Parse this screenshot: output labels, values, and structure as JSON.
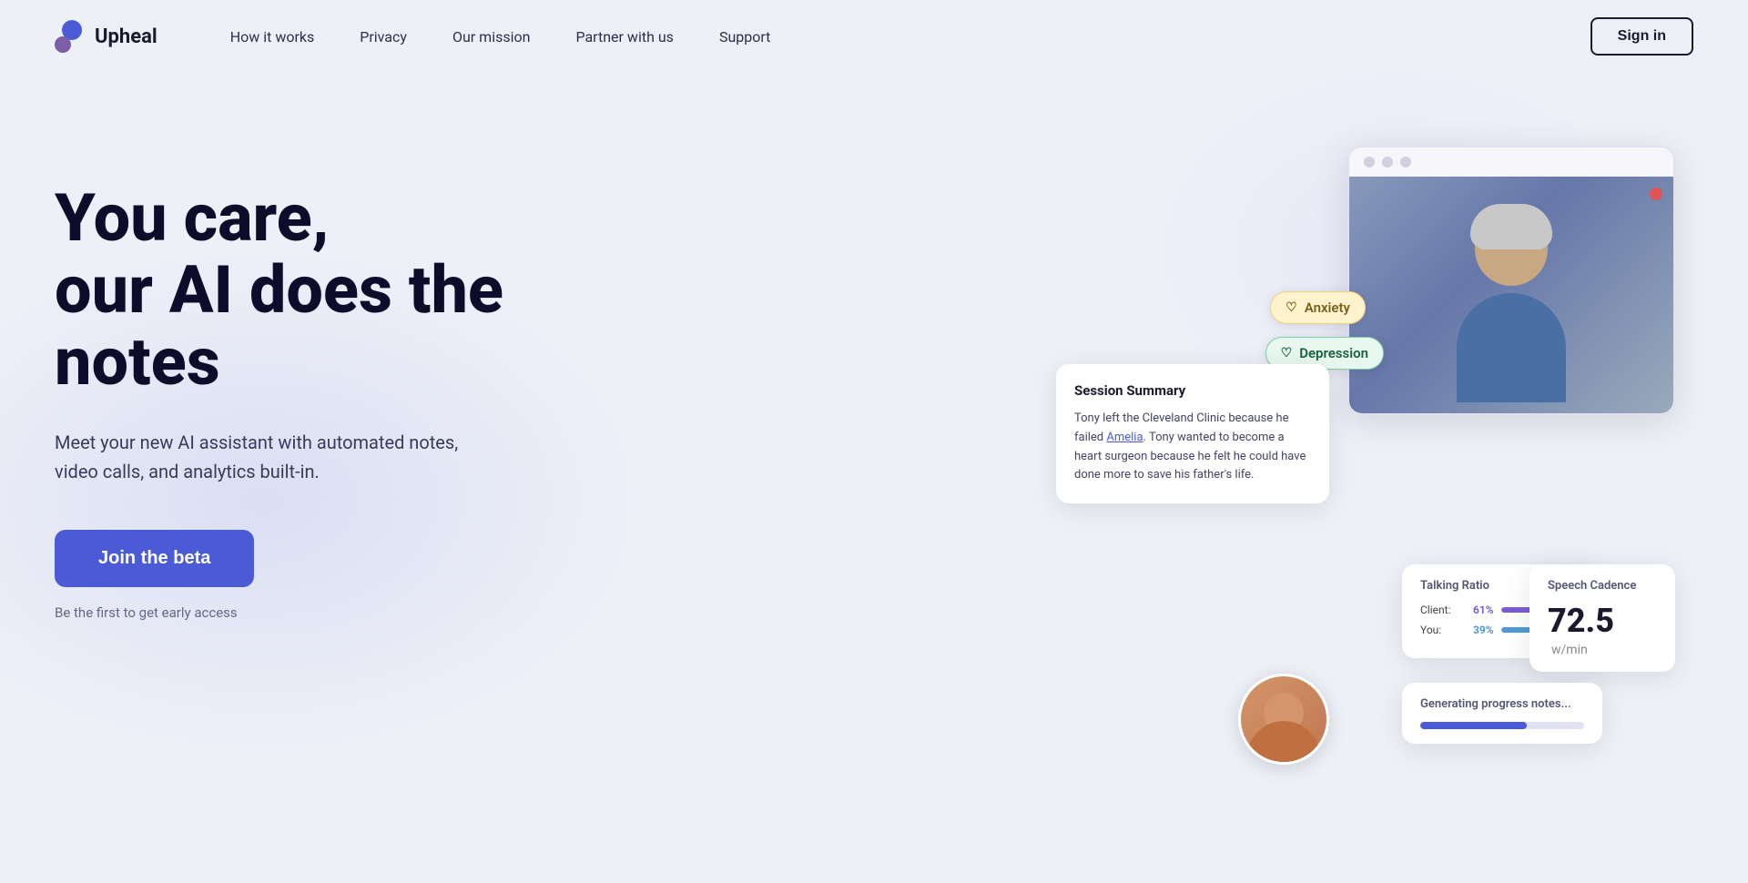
{
  "logo": {
    "text": "Upheal"
  },
  "nav": {
    "links": [
      {
        "label": "How it works",
        "id": "how-it-works"
      },
      {
        "label": "Privacy",
        "id": "privacy"
      },
      {
        "label": "Our mission",
        "id": "our-mission"
      },
      {
        "label": "Partner with us",
        "id": "partner-with-us"
      },
      {
        "label": "Support",
        "id": "support"
      }
    ],
    "sign_in_label": "Sign in"
  },
  "hero": {
    "title_line1": "You care,",
    "title_line2": "our AI does the notes",
    "subtitle": "Meet your new AI assistant with automated notes, video calls, and analytics built-in.",
    "cta_label": "Join the beta",
    "early_access_text": "Be the first to get early access"
  },
  "ui_mockup": {
    "video_window": {
      "traffic_lights": [
        "circle1",
        "circle2",
        "circle3"
      ]
    },
    "tags": [
      {
        "label": "Anxiety",
        "color": "yellow"
      },
      {
        "label": "Depression",
        "color": "green"
      }
    ],
    "session_card": {
      "title": "Session Summary",
      "text": "Tony left the Cleveland Clinic because he failed Amelia. Tony wanted to become a heart surgeon because he felt he could have done more to save his father's life.",
      "highlight": "Amelia"
    },
    "talking_ratio": {
      "title": "Talking Ratio",
      "client_label": "Client:",
      "client_pct": "61%",
      "client_width": "61%",
      "you_label": "You:",
      "you_pct": "39%",
      "you_width": "39%"
    },
    "speech_cadence": {
      "title": "Speech Cadence",
      "value": "72.5",
      "unit": "w/min"
    },
    "progress_notes": {
      "title": "Generating progress notes...",
      "progress": "65%"
    }
  }
}
